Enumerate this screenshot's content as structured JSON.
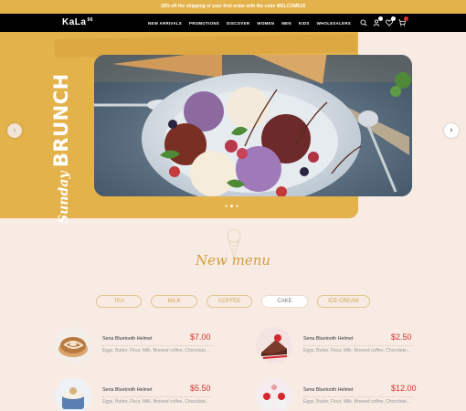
{
  "promo": {
    "text": "15% off the shipping of your first order with the code WELCOME15"
  },
  "header": {
    "logo": "KaLa",
    "logo_sub": "96",
    "menu": [
      "NEW ARRIVALS",
      "PROMOTIONS",
      "DISCOVER",
      "WOMEN",
      "MEN",
      "KIDS",
      "WHOLESALERS"
    ],
    "icons": [
      "search-icon",
      "user-icon",
      "heart-icon",
      "cart-icon"
    ]
  },
  "hero": {
    "title_script": "Sunday",
    "title_bold": "BRUNCH",
    "prev": "‹",
    "next": "›",
    "slides": 3,
    "active_slide": 1,
    "colors": {
      "background": "#e4b24a",
      "accent": "#d2342f"
    }
  },
  "menu_section": {
    "title": "New menu",
    "tabs": [
      "TEA",
      "MILK",
      "COFFEE",
      "CAKE",
      "ICE-CREAM"
    ],
    "active_tab": "CAKE"
  },
  "products": [
    {
      "name": "Sena Bluetooth Helmet",
      "price": "$7.00",
      "desc": "Eggs, Butter, Flour, Milk, Brewed coffee, Chocolate..."
    },
    {
      "name": "Sena Bluetooth Helmet",
      "price": "$2.50",
      "desc": "Eggs, Butter, Flour, Milk, Brewed coffee, Chocolate..."
    },
    {
      "name": "Sena Bluetooth Helmet",
      "price": "$5.50",
      "desc": "Eggs, Butter, Flour, Milk, Brewed coffee, Chocolate..."
    },
    {
      "name": "Sena Bluetooth Helmet",
      "price": "$12.00",
      "desc": "Eggs, Butter, Flour, Milk, Brewed coffee, Chocolate..."
    }
  ]
}
